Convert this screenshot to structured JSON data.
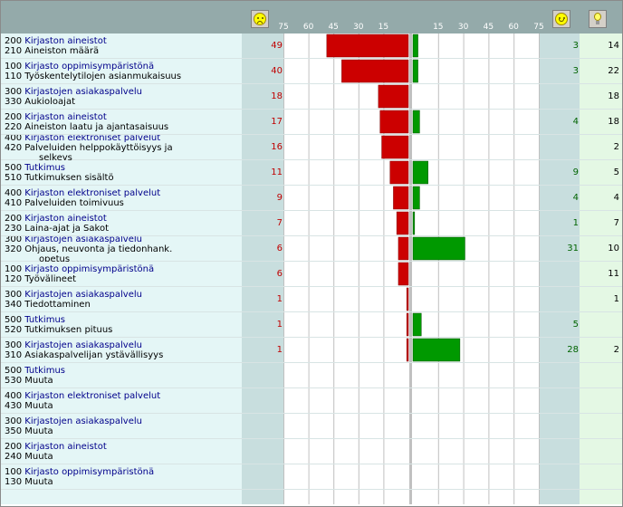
{
  "chart_data": {
    "type": "bar",
    "axis_left": {
      "ticks": [
        "75",
        "60",
        "45",
        "30",
        "15"
      ],
      "max": 75
    },
    "axis_right": {
      "ticks": [
        "15",
        "30",
        "45",
        "60",
        "75"
      ],
      "max": 75
    },
    "colors": {
      "negative": "#cc0000",
      "positive": "#009900",
      "grid": "#c0c0c0",
      "center": "#c0c0c0"
    },
    "icons": {
      "left": "sad-face-icon",
      "right": "happy-face-icon",
      "extra": "lightbulb-icon"
    },
    "rows": [
      {
        "code1": "200",
        "group": "Kirjaston aineistot",
        "code2": "210",
        "lines": [
          "Aineiston määrä"
        ],
        "neg": 49,
        "pos": 3,
        "extra": 14
      },
      {
        "code1": "100",
        "group": "Kirjasto oppimisympäristönä",
        "code2": "110",
        "lines": [
          "Työskentelytilojen asianmukaisuus"
        ],
        "neg": 40,
        "pos": 3,
        "extra": 22
      },
      {
        "code1": "300",
        "group": "Kirjastojen asiakaspalvelu",
        "code2": "330",
        "lines": [
          "Aukioloajat"
        ],
        "neg": 18,
        "pos": null,
        "extra": 18
      },
      {
        "code1": "200",
        "group": "Kirjaston aineistot",
        "code2": "220",
        "lines": [
          "Aineiston laatu ja ajantasaisuus"
        ],
        "neg": 17,
        "pos": 4,
        "extra": 18
      },
      {
        "code1": "400",
        "group": "Kirjaston elektroniset palvelut",
        "code2": "420",
        "lines": [
          "Palveluiden helppokäyttöisyys ja",
          "selkeys"
        ],
        "neg": 16,
        "pos": null,
        "extra": 2
      },
      {
        "code1": "500",
        "group": "Tutkimus",
        "code2": "510",
        "lines": [
          "Tutkimuksen sisältö"
        ],
        "neg": 11,
        "pos": 9,
        "extra": 5
      },
      {
        "code1": "400",
        "group": "Kirjaston elektroniset palvelut",
        "code2": "410",
        "lines": [
          "Palveluiden toimivuus"
        ],
        "neg": 9,
        "pos": 4,
        "extra": 4
      },
      {
        "code1": "200",
        "group": "Kirjaston aineistot",
        "code2": "230",
        "lines": [
          "Laina-ajat ja Sakot"
        ],
        "neg": 7,
        "pos": 1,
        "extra": 7
      },
      {
        "code1": "300",
        "group": "Kirjastojen asiakaspalvelu",
        "code2": "320",
        "lines": [
          "Ohjaus, neuvonta ja tiedonhank.",
          "opetus"
        ],
        "neg": 6,
        "pos": 31,
        "extra": 10
      },
      {
        "code1": "100",
        "group": "Kirjasto oppimisympäristönä",
        "code2": "120",
        "lines": [
          "Työvälineet"
        ],
        "neg": 6,
        "pos": null,
        "extra": 11
      },
      {
        "code1": "300",
        "group": "Kirjastojen asiakaspalvelu",
        "code2": "340",
        "lines": [
          "Tiedottaminen"
        ],
        "neg": 1,
        "pos": null,
        "extra": 1
      },
      {
        "code1": "500",
        "group": "Tutkimus",
        "code2": "520",
        "lines": [
          "Tutkimuksen pituus"
        ],
        "neg": 1,
        "pos": 5,
        "extra": null
      },
      {
        "code1": "300",
        "group": "Kirjastojen asiakaspalvelu",
        "code2": "310",
        "lines": [
          "Asiakaspalvelijan ystävällisyys"
        ],
        "neg": 1,
        "pos": 28,
        "extra": 2
      },
      {
        "code1": "500",
        "group": "Tutkimus",
        "code2": "530",
        "lines": [
          "Muuta"
        ],
        "neg": null,
        "pos": null,
        "extra": null
      },
      {
        "code1": "400",
        "group": "Kirjaston elektroniset palvelut",
        "code2": "430",
        "lines": [
          "Muuta"
        ],
        "neg": null,
        "pos": null,
        "extra": null
      },
      {
        "code1": "300",
        "group": "Kirjastojen asiakaspalvelu",
        "code2": "350",
        "lines": [
          "Muuta"
        ],
        "neg": null,
        "pos": null,
        "extra": null
      },
      {
        "code1": "200",
        "group": "Kirjaston aineistot",
        "code2": "240",
        "lines": [
          "Muuta"
        ],
        "neg": null,
        "pos": null,
        "extra": null
      },
      {
        "code1": "100",
        "group": "Kirjasto oppimisympäristönä",
        "code2": "130",
        "lines": [
          "Muuta"
        ],
        "neg": null,
        "pos": null,
        "extra": null
      }
    ]
  }
}
